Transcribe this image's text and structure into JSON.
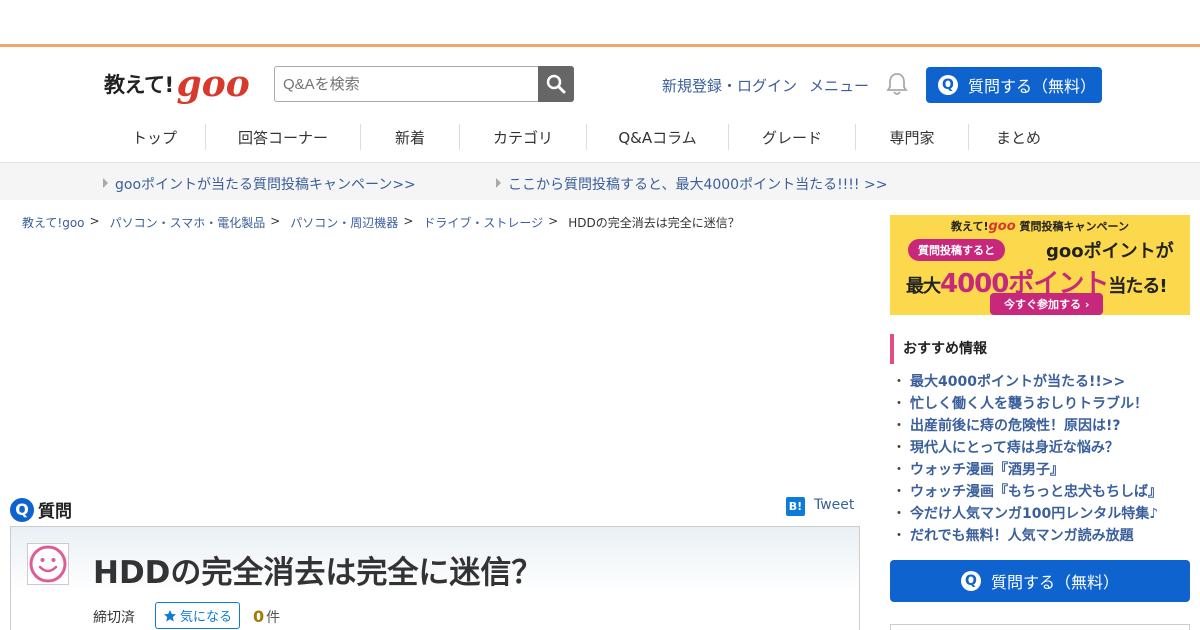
{
  "header": {
    "logo_text": "教えて!",
    "logo_goo": "goo",
    "search_placeholder": "Q&Aを検索",
    "register_login": "新規登録・ログイン",
    "menu": "メニュー",
    "ask_button": "質問する（無料）",
    "q_glyph": "Q"
  },
  "nav": [
    "トップ",
    "回答コーナー",
    "新着",
    "カテゴリ",
    "Q&Aコラム",
    "グレード",
    "専門家",
    "まとめ"
  ],
  "campaigns": [
    "gooポイントが当たる質問投稿キャンペーン>>",
    "ここから質問投稿すると、最大4000ポイント当たる!!!! >>"
  ],
  "breadcrumb": {
    "items": [
      "教えて!goo",
      "パソコン・スマホ・電化製品",
      "パソコン・周辺機器",
      "ドライブ・ストレージ"
    ],
    "separator": ">",
    "current": "HDDの完全消去は完全に迷信？"
  },
  "question": {
    "label": "質問",
    "q_glyph": "Q",
    "hatena_glyph": "B!",
    "tweet": "Tweet",
    "title": "HDDの完全消去は完全に迷信？",
    "status": "締切済",
    "favorite_label": "気になる",
    "count": "0",
    "count_unit": "件"
  },
  "banner": {
    "line1_prefix": "教えて!",
    "line1_goo": "goo",
    "line1_suffix": " 質問投稿キャンペーン",
    "pill": "質問投稿すると",
    "line2": "gooポイントが",
    "line3_prefix": "最大",
    "line3_main": "4000ポイント",
    "line3_suffix": "当たる!",
    "cta": "今すぐ参加する ›"
  },
  "recommend": {
    "title": "おすすめ情報",
    "bullet": "・",
    "items": [
      "最大4000ポイントが当たる!!>>",
      "忙しく働く人を襲うおしりトラブル！",
      "出産前後に痔の危険性！原因は!?",
      "現代人にとって痔は身近な悩み？",
      "ウォッチ漫画『酒男子』",
      "ウォッチ漫画『もちっと忠犬もちしば』",
      "今だけ人気マンガ100円レンタル特集♪",
      "だれでも無料！人気マンガ読み放題"
    ]
  },
  "sidebar": {
    "ask_button": "質問する（無料）"
  },
  "colors": {
    "primary_blue": "#0e63cf",
    "link_blue": "#3a5f9b",
    "goo_red": "#d73a2c",
    "accent_pink": "#e34e7e",
    "orange_line": "#f4a56a"
  },
  "icons": {
    "search": "search-icon",
    "bell": "bell-icon",
    "star": "star-icon",
    "smiley": "smiley-icon"
  }
}
